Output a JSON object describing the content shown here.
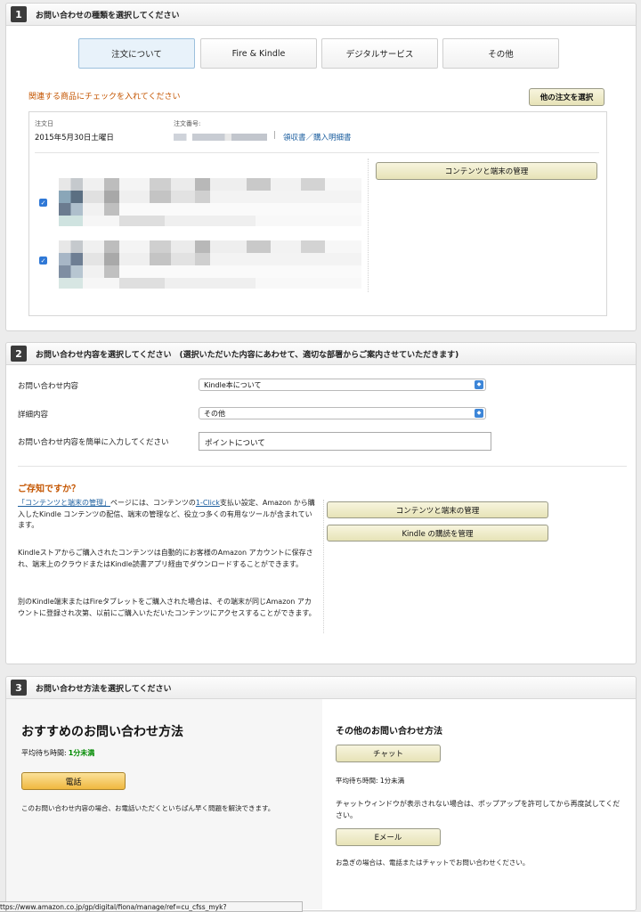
{
  "section1": {
    "number": "1",
    "title": "お問い合わせの種類を選択してください",
    "tabs": [
      "注文について",
      "Fire & Kindle",
      "デジタルサービス",
      "その他"
    ],
    "related_prompt": "関連する商品にチェックを入れてください",
    "other_order_button": "他の注文を選択",
    "order_date_label": "注文日",
    "order_date": "2015年5月30日土曜日",
    "order_number_label": "注文番号:",
    "receipt_link": "領収書／購入明細書",
    "separator": "|",
    "manage_button": "コンテンツと端末の管理",
    "check_glyph": "✓"
  },
  "section2": {
    "number": "2",
    "title": "お問い合わせ内容を選択してください　(選択いただいた内容にあわせて、適切な部署からご案内させていただきます)",
    "inquiry_label": "お問い合わせ内容",
    "inquiry_value": "Kindle本について",
    "detail_label": "詳細内容",
    "detail_value": "その他",
    "text_label": "お問い合わせ内容を簡単に入力してください",
    "text_value": "ポイントについて",
    "dyk_title": "ご存知ですか？",
    "dyk_link1": "「コンテンツと端末の管理」",
    "dyk_p1_mid": "ページには、コンテンツの",
    "dyk_link2": "1-Click",
    "dyk_p1_rest": "支払い設定、Amazon から購入したKindle コンテンツの配信、端末の管理など、役立つ多くの有用なツールが含まれています。",
    "dyk_p2": "Kindleストアからご購入されたコンテンツは自動的にお客様のAmazon アカウントに保存され、端末上のクラウドまたはKindle読書アプリ経由でダウンロードすることができます。",
    "dyk_p3": "別のKindle端末またはFireタブレットをご購入された場合は、その端末が同じAmazon アカウントに登録され次第、以前にご購入いただいたコンテンツにアクセスすることができます。",
    "btn_manage": "コンテンツと端末の管理",
    "btn_subscription": "Kindle の購読を管理"
  },
  "section3": {
    "number": "3",
    "title": "お問い合わせ方法を選択してください",
    "recommended_title": "おすすめのお問い合わせ方法",
    "wait_label": "平均待ち時間:",
    "wait_value": "1分未満",
    "phone_button": "電話",
    "phone_note": "このお問い合わせ内容の場合、お電話いただくといちばん早く問題を解決できます。",
    "other_title": "その他のお問い合わせ方法",
    "chat_button": "チャット",
    "chat_wait": "平均待ち時間: 1分未満",
    "chat_note": "チャットウィンドウが表示されない場合は、ポップアップを許可してから再度試してください。",
    "email_button": "Eメール",
    "email_note": "お急ぎの場合は、電話またはチャットでお問い合わせください。"
  },
  "status_bar": "ttps://www.amazon.co.jp/gp/digital/fiona/manage/ref=cu_cfss_myk?",
  "colors": {
    "accent_orange": "#c45500",
    "link": "#1a5d9e",
    "green": "#008a00",
    "checkbox": "#2f78d6"
  }
}
